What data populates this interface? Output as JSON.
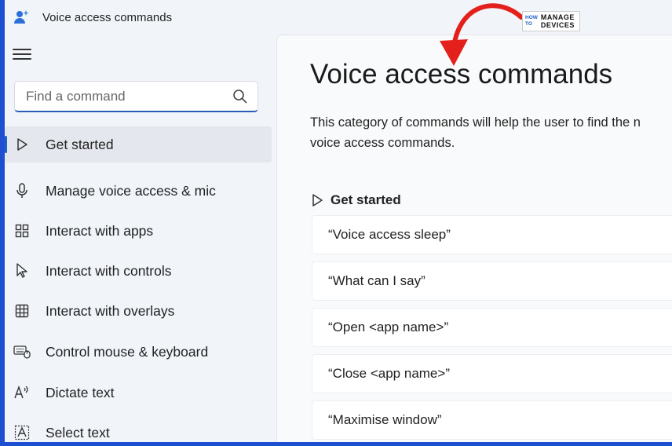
{
  "window": {
    "title": "Voice access commands"
  },
  "search": {
    "placeholder": "Find a command"
  },
  "sidebar": {
    "items": [
      {
        "label": "Get started",
        "icon": "play-outline-icon",
        "active": true
      },
      {
        "label": "Manage voice access & mic",
        "icon": "microphone-icon"
      },
      {
        "label": "Interact with apps",
        "icon": "apps-grid-icon"
      },
      {
        "label": "Interact with controls",
        "icon": "pointer-cursor-icon"
      },
      {
        "label": "Interact with overlays",
        "icon": "grid-overlay-icon"
      },
      {
        "label": "Control mouse & keyboard",
        "icon": "keyboard-mouse-icon"
      },
      {
        "label": "Dictate text",
        "icon": "dictate-text-icon"
      },
      {
        "label": "Select text",
        "icon": "select-text-icon"
      }
    ]
  },
  "main": {
    "title": "Voice access commands",
    "description_line1": "This category of commands will help the user to find the n",
    "description_line2": "voice access commands.",
    "section": {
      "label": "Get started"
    },
    "commands": [
      "“Voice access sleep”",
      "“What can I say”",
      "“Open <app name>”",
      "“Close <app name>”",
      "“Maximise window”"
    ]
  },
  "watermark": {
    "small_top": "HOW",
    "small_bottom": "TO",
    "line1": "MANAGE",
    "line2": "DEVICES"
  },
  "colors": {
    "accent": "#1f5fc8",
    "frame": "#1f4fd1",
    "annotation_arrow": "#e3201b"
  }
}
